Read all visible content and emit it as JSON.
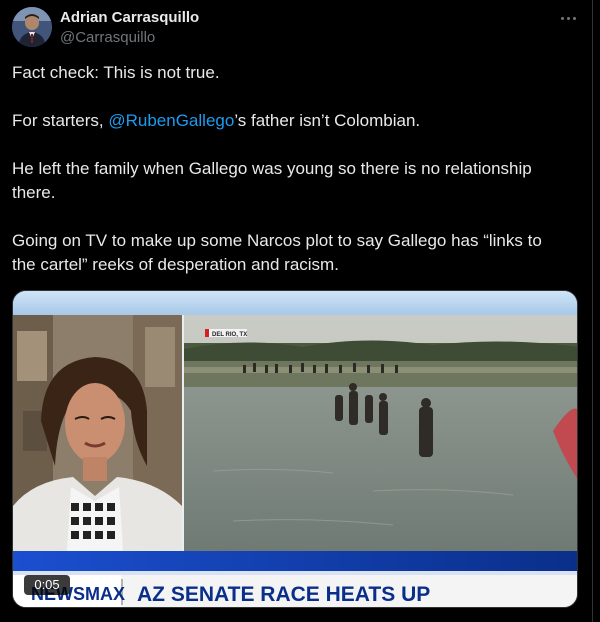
{
  "tweet": {
    "author_name": "Adrian Carrasquillo",
    "author_handle": "@Carrasquillo",
    "line1": "Fact check: This is not true.",
    "line2_prefix": "For starters, ",
    "line2_mention": "@RubenGallego",
    "line2_suffix": "’s father isn’t Colombian.",
    "line3a": "He left the family when Gallego was young so there is no relationship",
    "line3b": "there.",
    "line4a": "Going on TV to make up some Narcos plot to say Gallego has “links to",
    "line4b": "the cartel” reeks of desperation and racism."
  },
  "video": {
    "duration": "0:05",
    "location_tag": "DEL RIO, TX",
    "network_logo": "NEWSMAX",
    "headline": "AZ SENATE RACE HEATS UP"
  },
  "icons": {
    "more": "more-horizontal-icon"
  },
  "colors": {
    "background": "#000000",
    "text": "#e7e9ea",
    "secondary": "#71767b",
    "link": "#1d9bf0",
    "chyron_blue": "#0a2f8a"
  }
}
